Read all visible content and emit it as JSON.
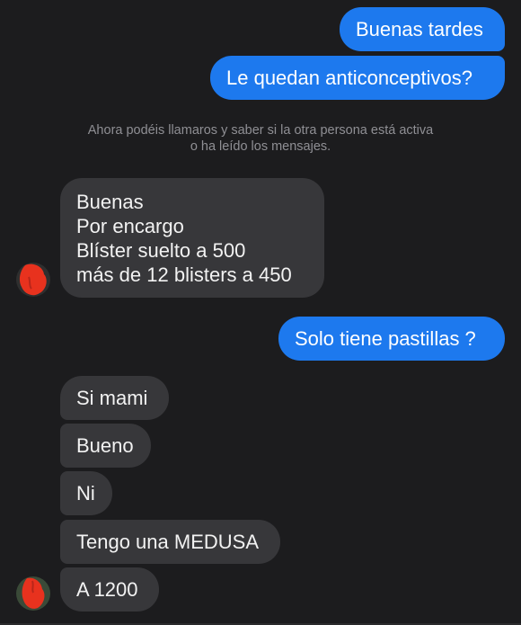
{
  "conversation": {
    "outgoing_1": "Buenas tardes",
    "outgoing_2": "Le quedan anticonceptivos?",
    "notice_line_1": "Ahora podéis llamaros y saber si la otra persona está activa",
    "notice_line_2": "o ha leído los mensajes.",
    "incoming_block": [
      "Buenas",
      "Por encargo",
      "Blíster suelto a 500",
      "más de 12 blisters a 450"
    ],
    "outgoing_3": "Solo tiene pastillas ?",
    "incoming_1": "Si mami",
    "incoming_2": "Bueno",
    "incoming_3": "Ni",
    "incoming_4": "Tengo una MEDUSA",
    "incoming_5": "A 1200"
  },
  "colors": {
    "outgoing_bubble": "#1d79ee",
    "incoming_bubble": "#37373a",
    "background": "#1c1c1e",
    "redaction": "#e8321e"
  }
}
